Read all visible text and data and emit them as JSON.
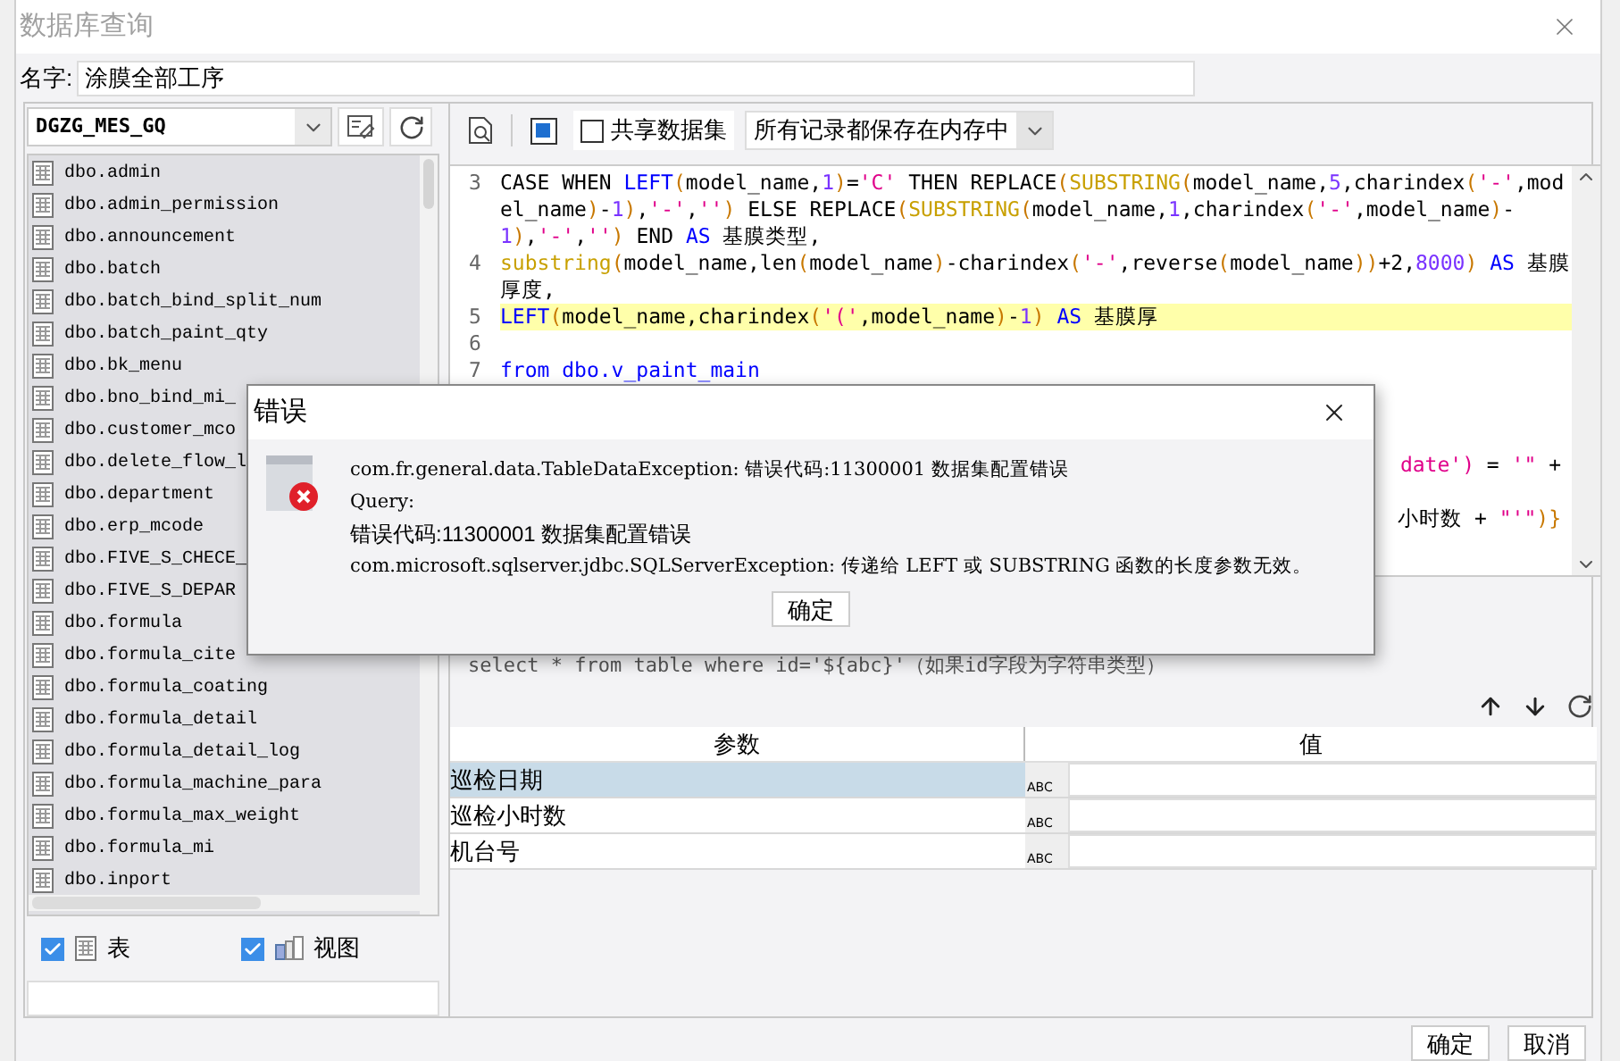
{
  "window": {
    "title": "数据库查询"
  },
  "name_field": {
    "label": "名字:",
    "value": "涂膜全部工序"
  },
  "connection": {
    "value": "DGZG_MES_GQ"
  },
  "tables": [
    {
      "name": "dbo.admin"
    },
    {
      "name": "dbo.admin_permission"
    },
    {
      "name": "dbo.announcement"
    },
    {
      "name": "dbo.batch"
    },
    {
      "name": "dbo.batch_bind_split_num"
    },
    {
      "name": "dbo.batch_paint_qty"
    },
    {
      "name": "dbo.bk_menu"
    },
    {
      "name": "dbo.bno_bind_mi_"
    },
    {
      "name": "dbo.customer_mco"
    },
    {
      "name": "dbo.delete_flow_l"
    },
    {
      "name": "dbo.department"
    },
    {
      "name": "dbo.erp_mcode"
    },
    {
      "name": "dbo.FIVE_S_CHECE_"
    },
    {
      "name": "dbo.FIVE_S_DEPAR"
    },
    {
      "name": "dbo.formula"
    },
    {
      "name": "dbo.formula_cite"
    },
    {
      "name": "dbo.formula_coating"
    },
    {
      "name": "dbo.formula_detail"
    },
    {
      "name": "dbo.formula_detail_log"
    },
    {
      "name": "dbo.formula_machine_para"
    },
    {
      "name": "dbo.formula_max_weight"
    },
    {
      "name": "dbo.formula_mi"
    },
    {
      "name": "dbo.inport"
    }
  ],
  "filters": [
    {
      "kind": "table",
      "label": "表",
      "checked": true
    },
    {
      "kind": "view",
      "label": "视图",
      "checked": true
    }
  ],
  "toolbar": {
    "share_dataset": {
      "label": "共享数据集",
      "checked": false
    },
    "storage_mode": {
      "value": "所有记录都保存在内存中"
    }
  },
  "code_lines": [
    {
      "number": "3",
      "highlighted": false,
      "segments": [
        {
          "kind": "plain",
          "text": "CASE WHEN "
        },
        {
          "kind": "keyword",
          "text": "LEFT"
        },
        {
          "kind": "paren",
          "text": "("
        },
        {
          "kind": "plain",
          "text": "model_name,"
        },
        {
          "kind": "number",
          "text": "1"
        },
        {
          "kind": "paren",
          "text": ")"
        },
        {
          "kind": "plain",
          "text": "="
        },
        {
          "kind": "string",
          "text": "'C'"
        },
        {
          "kind": "plain",
          "text": " THEN REPLACE"
        },
        {
          "kind": "paren",
          "text": "("
        },
        {
          "kind": "function",
          "text": "SUBSTRING"
        },
        {
          "kind": "paren",
          "text": "("
        },
        {
          "kind": "plain",
          "text": "model_name,"
        },
        {
          "kind": "number",
          "text": "5"
        },
        {
          "kind": "plain",
          "text": ",charindex"
        },
        {
          "kind": "paren",
          "text": "("
        },
        {
          "kind": "string",
          "text": "'-'"
        },
        {
          "kind": "plain",
          "text": ",model_name"
        },
        {
          "kind": "paren",
          "text": ")"
        },
        {
          "kind": "plain",
          "text": "-"
        },
        {
          "kind": "number",
          "text": "1"
        },
        {
          "kind": "paren",
          "text": ")"
        },
        {
          "kind": "plain",
          "text": ","
        },
        {
          "kind": "string",
          "text": "'-'"
        },
        {
          "kind": "plain",
          "text": ","
        },
        {
          "kind": "string",
          "text": "''"
        },
        {
          "kind": "paren",
          "text": ")"
        },
        {
          "kind": "plain",
          "text": " ELSE REPLACE"
        },
        {
          "kind": "paren",
          "text": "("
        },
        {
          "kind": "function",
          "text": "SUBSTRING"
        },
        {
          "kind": "paren",
          "text": "("
        },
        {
          "kind": "plain",
          "text": "model_name,"
        },
        {
          "kind": "number",
          "text": "1"
        },
        {
          "kind": "plain",
          "text": ",charindex"
        },
        {
          "kind": "paren",
          "text": "("
        },
        {
          "kind": "string",
          "text": "'-'"
        },
        {
          "kind": "plain",
          "text": ",model_name"
        },
        {
          "kind": "paren",
          "text": ")"
        },
        {
          "kind": "plain",
          "text": "-"
        },
        {
          "kind": "number",
          "text": "1"
        },
        {
          "kind": "paren",
          "text": ")"
        },
        {
          "kind": "plain",
          "text": ","
        },
        {
          "kind": "string",
          "text": "'-'"
        },
        {
          "kind": "plain",
          "text": ","
        },
        {
          "kind": "string",
          "text": "''"
        },
        {
          "kind": "paren",
          "text": ")"
        },
        {
          "kind": "plain",
          "text": " END "
        },
        {
          "kind": "keyword",
          "text": "AS"
        },
        {
          "kind": "plain",
          "text": " 基膜类型,"
        }
      ]
    },
    {
      "number": "4",
      "highlighted": false,
      "segments": [
        {
          "kind": "function",
          "text": "substring"
        },
        {
          "kind": "paren",
          "text": "("
        },
        {
          "kind": "plain",
          "text": "model_name,len"
        },
        {
          "kind": "paren",
          "text": "("
        },
        {
          "kind": "plain",
          "text": "model_name"
        },
        {
          "kind": "paren",
          "text": ")"
        },
        {
          "kind": "plain",
          "text": "-charindex"
        },
        {
          "kind": "paren",
          "text": "("
        },
        {
          "kind": "string",
          "text": "'-'"
        },
        {
          "kind": "plain",
          "text": ",reverse"
        },
        {
          "kind": "paren",
          "text": "("
        },
        {
          "kind": "plain",
          "text": "model_name"
        },
        {
          "kind": "paren",
          "text": "))"
        },
        {
          "kind": "plain",
          "text": "+2,"
        },
        {
          "kind": "number",
          "text": "8000"
        },
        {
          "kind": "paren",
          "text": ")"
        },
        {
          "kind": "keyword",
          "text": " AS"
        },
        {
          "kind": "plain",
          "text": " 基膜厚度,"
        }
      ]
    },
    {
      "number": "5",
      "highlighted": true,
      "segments": [
        {
          "kind": "keyword",
          "text": "LEFT"
        },
        {
          "kind": "paren",
          "text": "("
        },
        {
          "kind": "plain",
          "text": "model_name,charindex"
        },
        {
          "kind": "paren",
          "text": "("
        },
        {
          "kind": "string",
          "text": "'('"
        },
        {
          "kind": "plain",
          "text": ",model_name"
        },
        {
          "kind": "paren",
          "text": ")"
        },
        {
          "kind": "plain",
          "text": "-"
        },
        {
          "kind": "number",
          "text": "1"
        },
        {
          "kind": "paren",
          "text": ")"
        },
        {
          "kind": "keyword",
          "text": " AS"
        },
        {
          "kind": "plain",
          "text": " 基膜厚"
        }
      ]
    },
    {
      "number": "6",
      "highlighted": false
    },
    {
      "number": "7",
      "highlighted": false,
      "segments": [
        {
          "kind": "keyword",
          "text": "from dbo.v_paint_main"
        }
      ]
    }
  ],
  "code_fragments": [
    [
      {
        "kind": "string",
        "text": "date')"
      },
      {
        "kind": "plain",
        "text": " = "
      },
      {
        "kind": "string",
        "text": "'\""
      },
      {
        "kind": "plain",
        "text": " +"
      }
    ],
    [
      {
        "kind": "plain",
        "text": "小时数 + "
      },
      {
        "kind": "string",
        "text": "\"'\""
      },
      {
        "kind": "paren",
        "text": ")}"
      }
    ]
  ],
  "hint": "select * from table where id='${abc}'（如果id字段为字符串类型）",
  "parameters": {
    "columns": [
      "参数",
      "值"
    ],
    "rows": [
      {
        "name": "巡检日期",
        "selected": true,
        "type_label": "ABC"
      },
      {
        "name": "巡检小时数",
        "selected": false,
        "type_label": "ABC"
      },
      {
        "name": "机台号",
        "selected": false,
        "type_label": "ABC"
      }
    ]
  },
  "dialog": {
    "title": "错误",
    "lines": [
      {
        "kind": "mono",
        "text": "com.fr.general.data.TableDataException: 错误代码:11300001 数据集配置错误"
      },
      {
        "kind": "mono",
        "text": "Query:"
      },
      {
        "kind": "text",
        "text": "错误代码:11300001 数据集配置错误"
      },
      {
        "kind": "mono",
        "text": "com.microsoft.sqlserver.jdbc.SQLServerException: 传递给 LEFT 或 SUBSTRING 函数的长度参数无效。"
      }
    ],
    "button": "确定"
  },
  "buttons": [
    "确定",
    "取消"
  ]
}
